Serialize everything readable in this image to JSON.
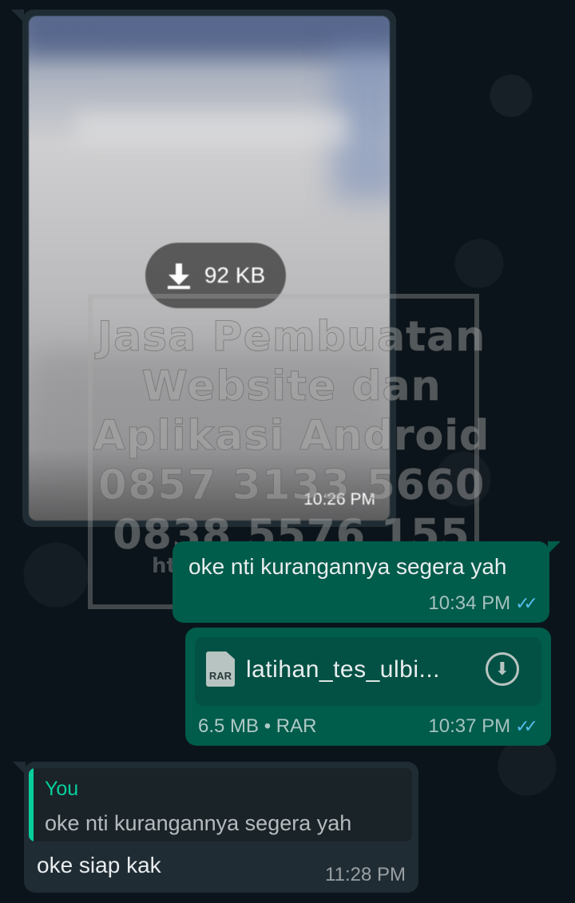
{
  "image_message": {
    "download_size": "92 KB",
    "time": "10:26 PM"
  },
  "watermark": {
    "lines": [
      "Jasa Pembuatan",
      "Website dan",
      "Aplikasi Android",
      "0857 3133 5660",
      "0838 5576 155"
    ],
    "url": "https://"
  },
  "outgoing_text": {
    "text": "oke nti kurangannya segera yah",
    "time": "10:34 PM",
    "status_icon": "double-check-icon"
  },
  "outgoing_file": {
    "file_type_badge": "RAR",
    "file_name": "latihan_tes_ulbi...",
    "info": "6.5 MB • RAR",
    "time": "10:37 PM",
    "status_icon": "double-check-icon"
  },
  "incoming_reply": {
    "quote_author": "You",
    "quote_text": "oke nti kurangannya segera yah",
    "text": "oke siap kak",
    "time": "11:28 PM"
  },
  "colors": {
    "background": "#0b141a",
    "incoming_bubble": "#202c33",
    "outgoing_bubble": "#005c4b",
    "read_ticks": "#53bdeb",
    "quote_accent": "#06cf9c"
  }
}
